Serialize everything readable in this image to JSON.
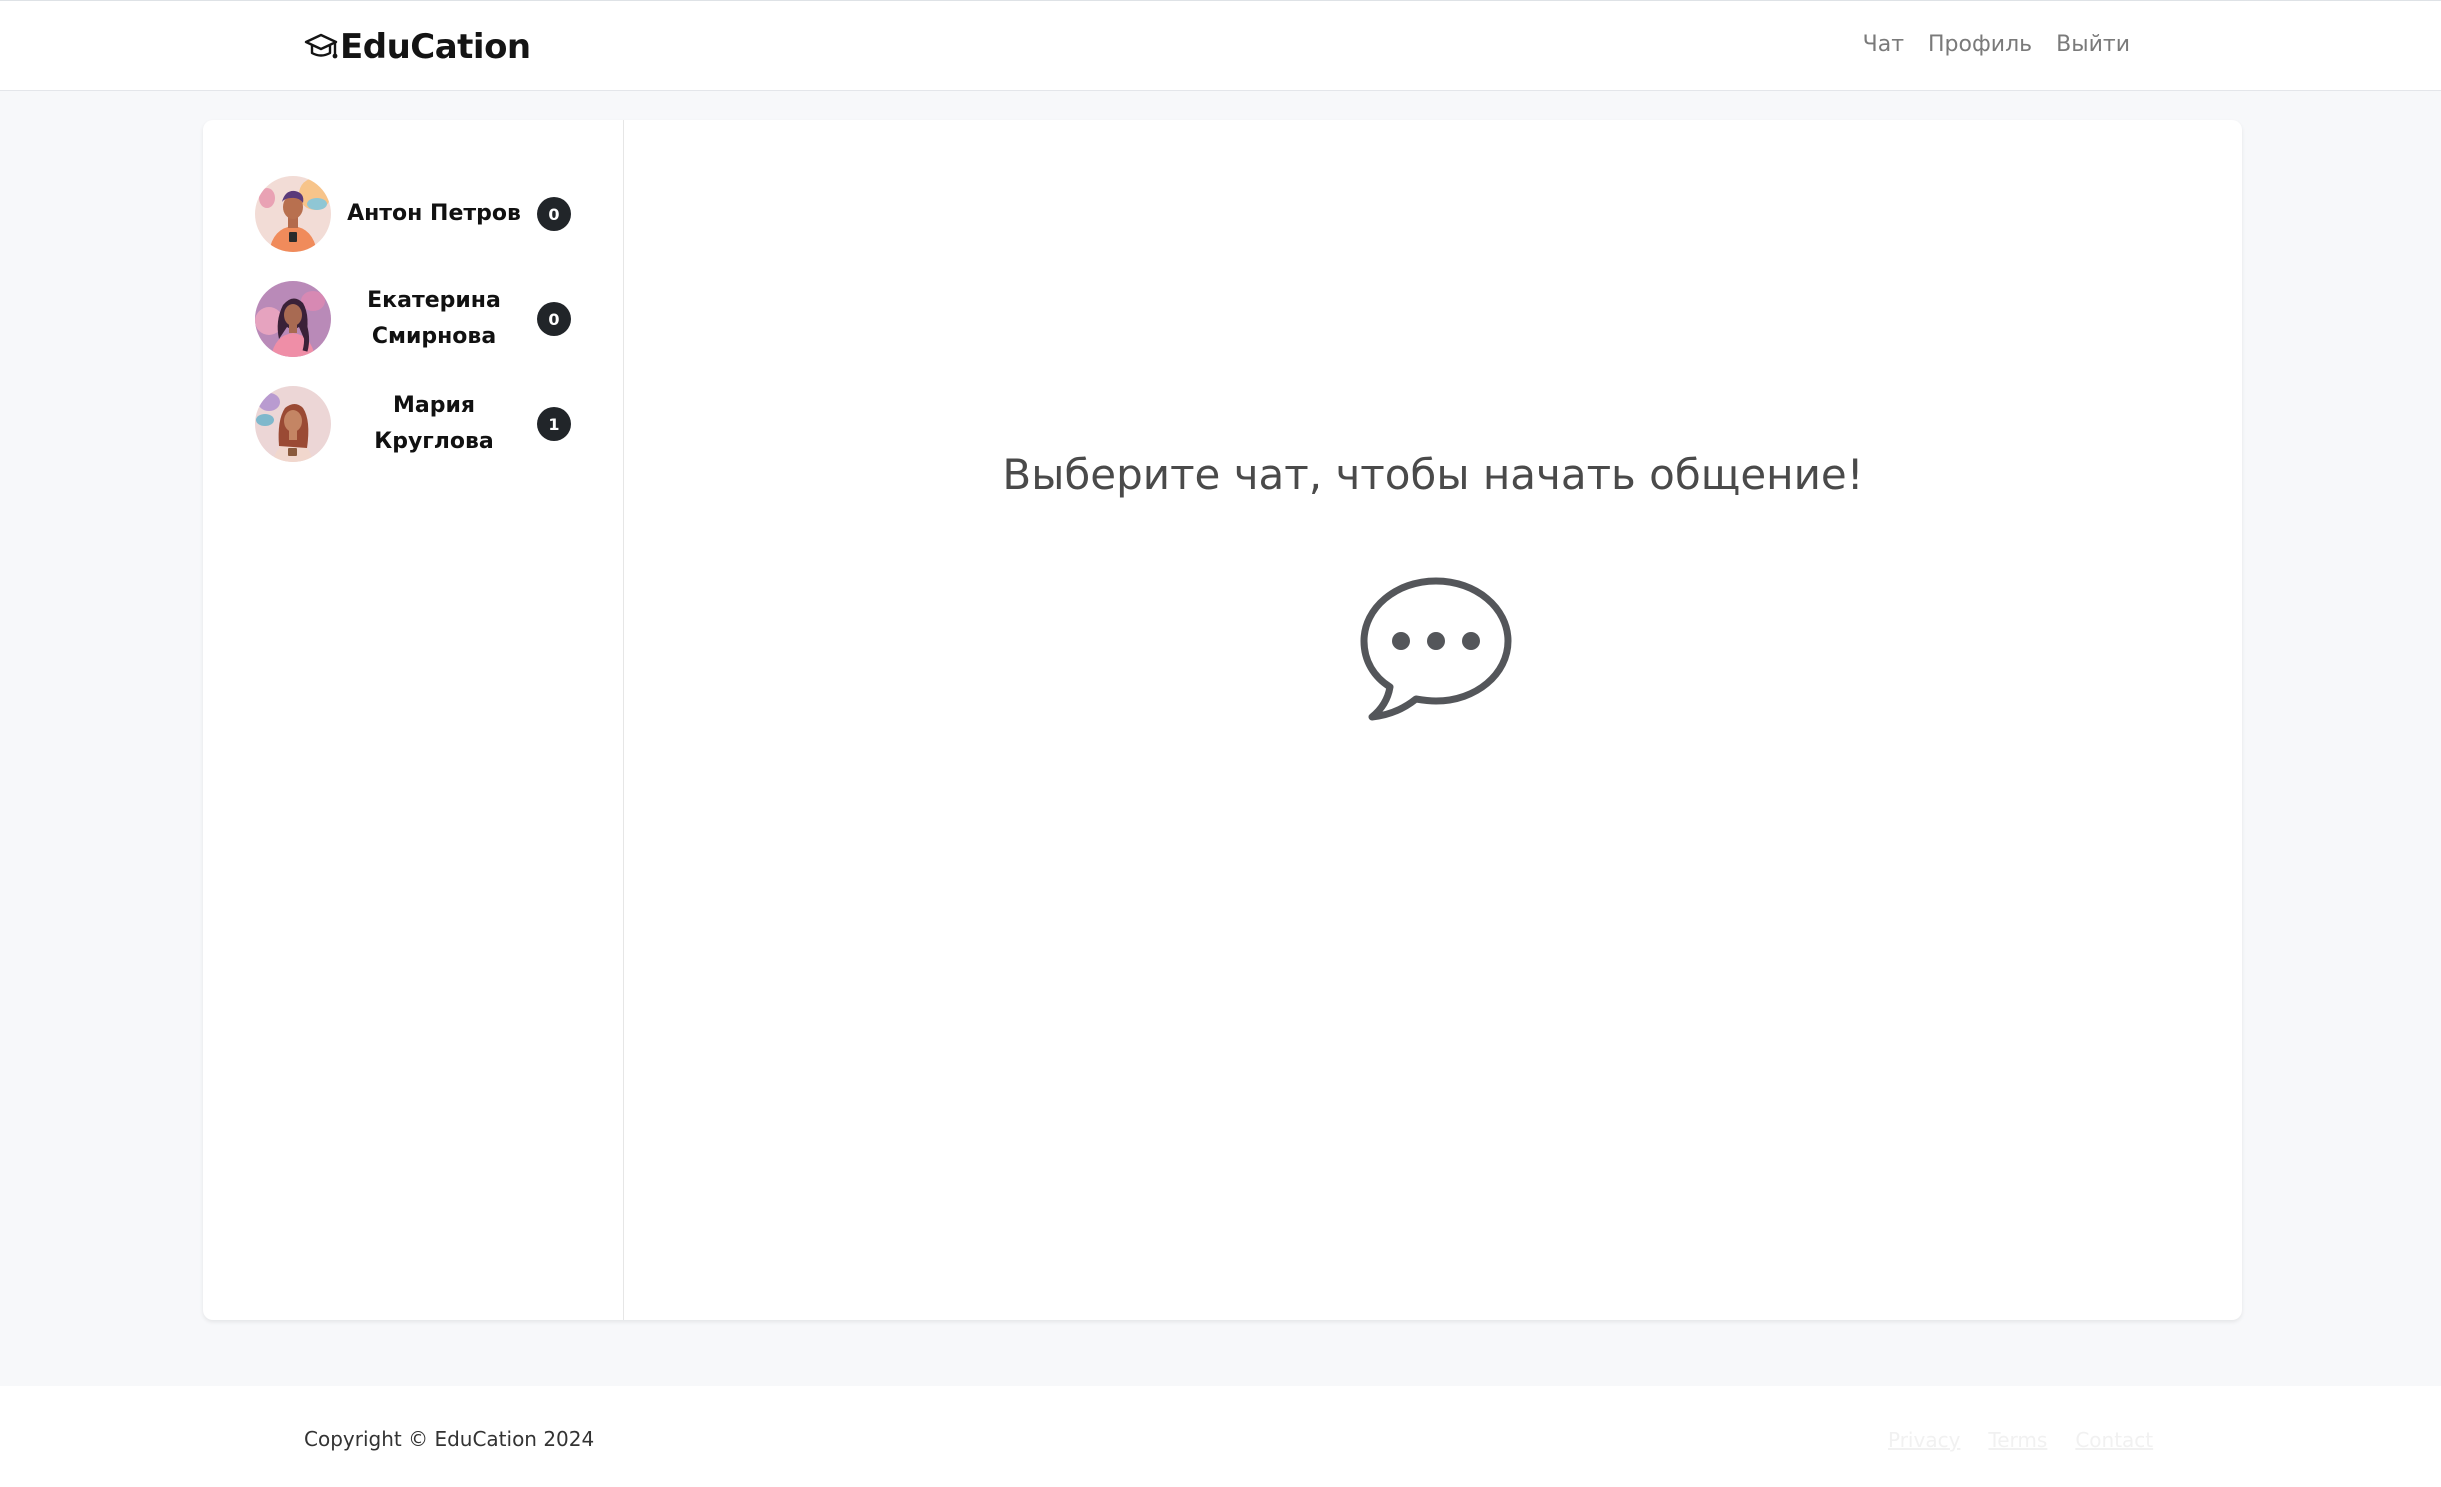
{
  "brand": {
    "name": "EduCation",
    "icon": "graduation-cap-icon"
  },
  "nav": {
    "chat": "Чат",
    "profile": "Профиль",
    "logout": "Выйти"
  },
  "contacts": [
    {
      "name": "Антон Петров",
      "unread": "0"
    },
    {
      "name": "Екатерина Смирнова",
      "unread": "0"
    },
    {
      "name": "Мария Круглова",
      "unread": "1"
    }
  ],
  "main": {
    "prompt": "Выберите чат, чтобы начать общение!",
    "icon": "chat-dots-icon"
  },
  "footer": {
    "copyright": "Copyright © EduCation 2024",
    "privacy": "Privacy",
    "terms": "Terms",
    "contact": "Contact"
  },
  "colors": {
    "badge": "#212529",
    "background": "#f7f8fa",
    "text": "#4a4a4a"
  }
}
